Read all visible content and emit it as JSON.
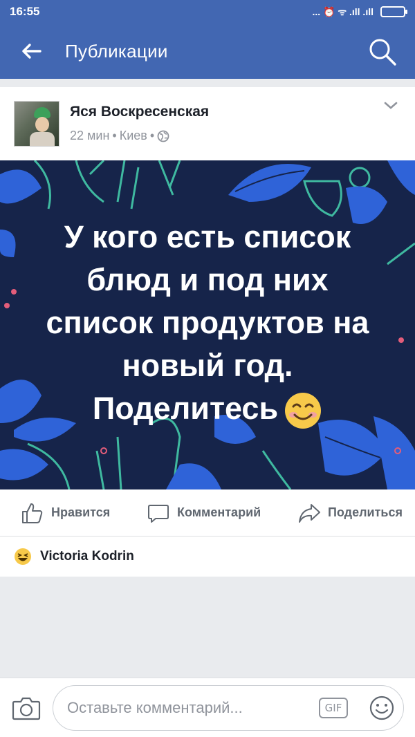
{
  "status_bar": {
    "time": "16:55",
    "icons": [
      "more-dots-icon",
      "alarm-off-icon",
      "wifi-icon",
      "signal-icon",
      "signal-icon",
      "battery-icon"
    ],
    "icons_text": "... ⏰ ᯤ .ıll .ıll"
  },
  "header": {
    "title": "Публикации",
    "back_icon": "arrow-left-icon",
    "search_icon": "search-icon",
    "background_color": "#4267b2"
  },
  "post": {
    "author": "Яся Воскресенская",
    "time": "22 мин",
    "location": "Киев",
    "separator": "•",
    "image_text_lines": [
      "У кого есть список",
      "блюд и под них",
      "список продуктов на",
      "новый год.",
      "Поделитесь"
    ],
    "image_background": "#16244a",
    "accent_blue": "#2f63d8",
    "accent_green": "#3fb9a0",
    "accent_pink": "#e35d7a"
  },
  "actions": {
    "like": "Нравится",
    "comment": "Комментарий",
    "share": "Поделиться"
  },
  "reaction": {
    "type": "haha-icon",
    "name": "Victoria Kodrin"
  },
  "comment_bar": {
    "placeholder": "Оставьте комментарий...",
    "gif_label": "GIF",
    "camera_icon": "camera-icon",
    "emoji_icon": "emoji-icon"
  }
}
